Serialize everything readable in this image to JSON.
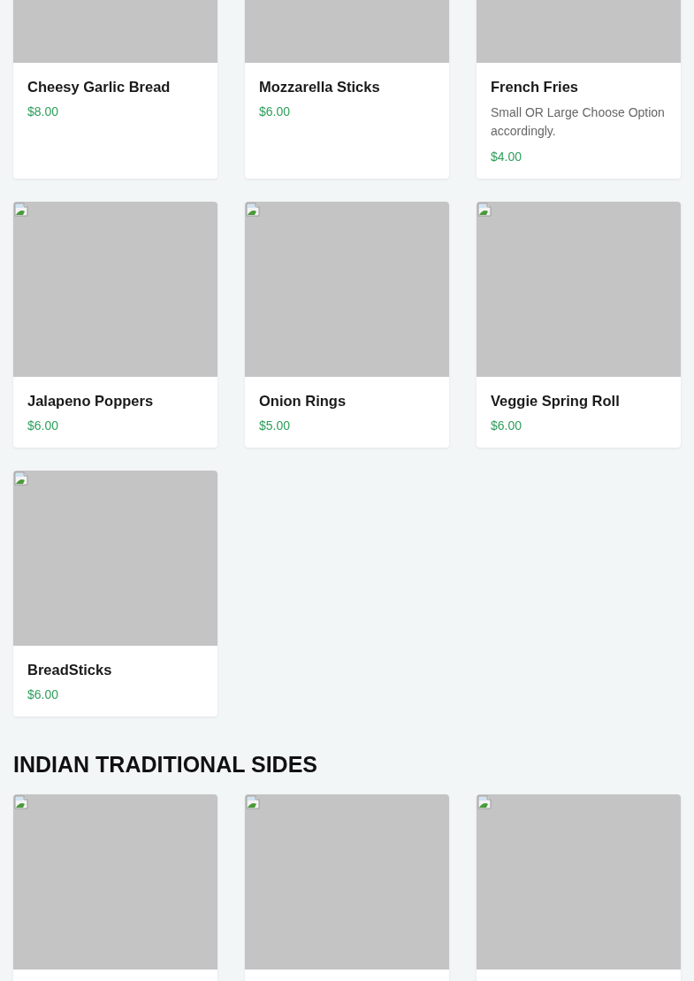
{
  "sections": [
    {
      "items": [
        {
          "kind": "dish",
          "name": "Cheesy Garlic Bread",
          "price": "$8.00"
        },
        {
          "kind": "dish",
          "name": "Mozzarella Sticks",
          "price": "$6.00"
        },
        {
          "kind": "dish",
          "name": "French Fries",
          "description": "Small OR Large Choose Option accordingly.",
          "price": "$4.00"
        },
        {
          "kind": "dish",
          "name": "Jalapeno Poppers",
          "price": "$6.00"
        },
        {
          "kind": "dish",
          "name": "Onion Rings",
          "price": "$5.00"
        },
        {
          "kind": "dish",
          "name": "Veggie Spring Roll",
          "price": "$6.00"
        },
        {
          "kind": "dish",
          "name": "BreadSticks",
          "price": "$6.00"
        }
      ]
    },
    {
      "title": "INDIAN TRADITIONAL SIDES"
    }
  ]
}
